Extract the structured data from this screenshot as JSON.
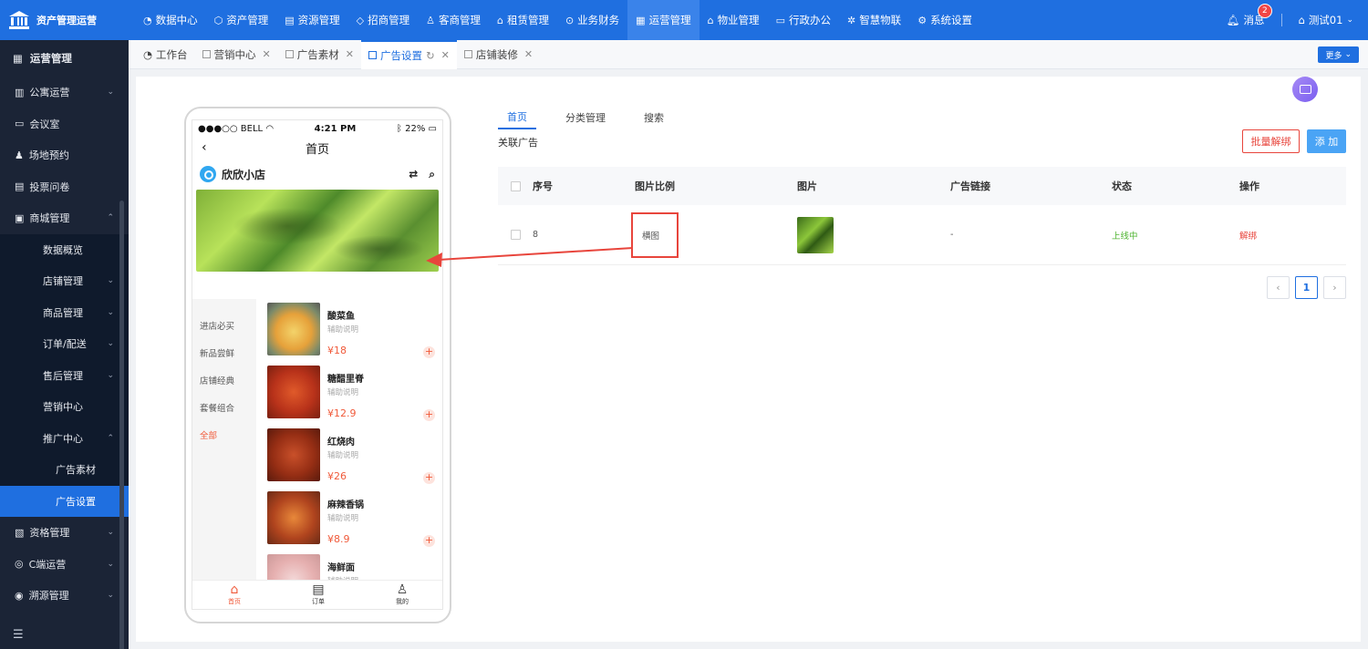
{
  "app": {
    "title": "资产管理运营"
  },
  "topnav": [
    {
      "label": "数据中心",
      "icon": "dashboard-icon"
    },
    {
      "label": "资产管理",
      "icon": "cube-icon"
    },
    {
      "label": "资源管理",
      "icon": "building-icon"
    },
    {
      "label": "招商管理",
      "icon": "tag-icon"
    },
    {
      "label": "客商管理",
      "icon": "users-icon"
    },
    {
      "label": "租赁管理",
      "icon": "home-icon"
    },
    {
      "label": "业务财务",
      "icon": "coin-icon"
    },
    {
      "label": "运营管理",
      "icon": "grid-icon",
      "active": true
    },
    {
      "label": "物业管理",
      "icon": "house-icon"
    },
    {
      "label": "行政办公",
      "icon": "monitor-icon"
    },
    {
      "label": "智慧物联",
      "icon": "atom-icon"
    },
    {
      "label": "系统设置",
      "icon": "gear-icon"
    }
  ],
  "header": {
    "messages_label": "消息",
    "message_count": "2",
    "user_name": "测试01"
  },
  "sidebar": {
    "title": "运营管理",
    "items": [
      {
        "label": "公寓运营"
      },
      {
        "label": "会议室"
      },
      {
        "label": "场地预约"
      },
      {
        "label": "投票问卷"
      },
      {
        "label": "商城管理"
      }
    ],
    "mall_sub": [
      {
        "label": "数据概览"
      },
      {
        "label": "店铺管理"
      },
      {
        "label": "商品管理"
      },
      {
        "label": "订单/配送"
      },
      {
        "label": "售后管理"
      },
      {
        "label": "营销中心"
      },
      {
        "label": "推广中心"
      }
    ],
    "promo_sub": [
      {
        "label": "广告素材"
      },
      {
        "label": "广告设置"
      }
    ],
    "bottom_items": [
      {
        "label": "资格管理"
      },
      {
        "label": "C端运营"
      },
      {
        "label": "溯源管理"
      }
    ]
  },
  "tabs": {
    "items": [
      {
        "label": "工作台"
      },
      {
        "label": "营销中心"
      },
      {
        "label": "广告素材"
      },
      {
        "label": "广告设置"
      },
      {
        "label": "店铺装修"
      }
    ],
    "more_label": "更多"
  },
  "phone": {
    "carrier": "●●●○○ BELL",
    "time": "4:21 PM",
    "battery": "22%",
    "page_title": "首页",
    "shop_name": "欣欣小店",
    "categories": [
      "进店必买",
      "新品尝鲜",
      "店铺经典",
      "套餐组合",
      "全部"
    ],
    "goods": [
      {
        "name": "酸菜鱼",
        "desc": "辅助说明",
        "price": "¥18"
      },
      {
        "name": "糖醋里脊",
        "desc": "辅助说明",
        "price": "¥12.9"
      },
      {
        "name": "红烧肉",
        "desc": "辅助说明",
        "price": "¥26"
      },
      {
        "name": "麻辣香锅",
        "desc": "辅助说明",
        "price": "¥8.9"
      },
      {
        "name": "海鲜面",
        "desc": "辅助说明",
        "price": ""
      }
    ],
    "tabbar": [
      {
        "label": "首页",
        "icon": "home-icon"
      },
      {
        "label": "订单",
        "icon": "document-icon"
      },
      {
        "label": "我的",
        "icon": "user-icon"
      }
    ]
  },
  "panel": {
    "tabs": [
      "首页",
      "分类管理",
      "搜索"
    ],
    "section_title": "关联广告",
    "batch_unbind": "批量解绑",
    "add": "添 加",
    "columns": [
      "序号",
      "图片比例",
      "图片",
      "广告链接",
      "状态",
      "操作"
    ],
    "rows": [
      {
        "no": "8",
        "ratio": "横图",
        "link": "-",
        "status": "上线中",
        "action": "解绑"
      }
    ],
    "current_page": "1"
  },
  "colors": {
    "brand": "#1f6fe0",
    "danger": "#e8453c",
    "success": "#52b535",
    "accent_orange": "#f05a3a"
  }
}
